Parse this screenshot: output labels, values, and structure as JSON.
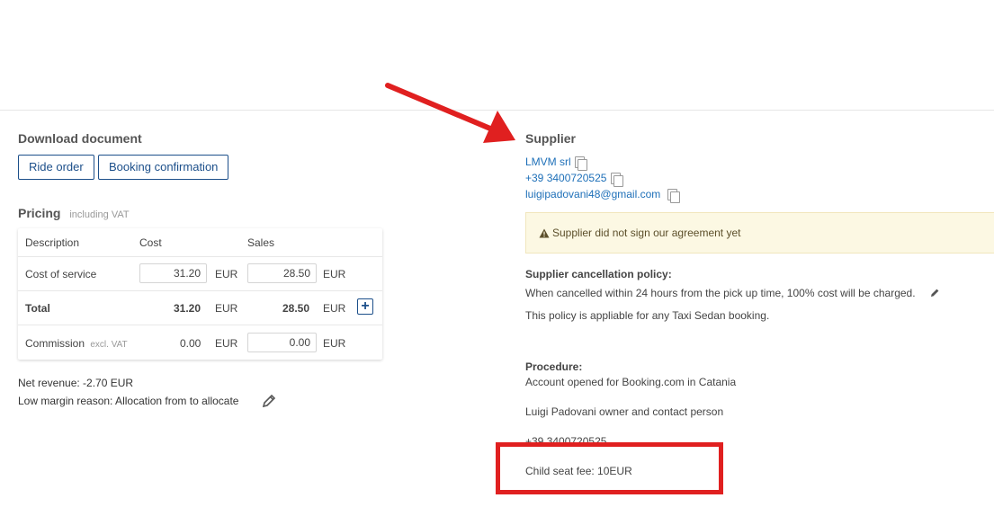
{
  "download": {
    "title": "Download document",
    "buttons": [
      "Ride order",
      "Booking confirmation"
    ]
  },
  "pricing": {
    "title": "Pricing",
    "subtitle": "including VAT",
    "headers": {
      "description": "Description",
      "cost": "Cost",
      "sales": "Sales"
    },
    "cost_of_service": {
      "label": "Cost of service",
      "cost": "31.20",
      "cost_currency": "EUR",
      "sales": "28.50",
      "sales_currency": "EUR"
    },
    "total": {
      "label": "Total",
      "cost": "31.20",
      "cost_currency": "EUR",
      "sales": "28.50",
      "sales_currency": "EUR",
      "add_button": "+"
    },
    "commission": {
      "label": "Commission",
      "note": "excl. VAT",
      "cost": "0.00",
      "cost_currency": "EUR",
      "sales": "0.00",
      "sales_currency": "EUR"
    },
    "net_revenue": "Net revenue: -2.70 EUR",
    "low_margin": "Low margin reason: Allocation from to allocate"
  },
  "supplier": {
    "title": "Supplier",
    "name": "LMVM srl",
    "phone": "+39 3400720525",
    "email": "luigipadovani48@gmail.com",
    "alert": "Supplier did not sign our agreement yet",
    "cancellation_title": "Supplier cancellation policy:",
    "cancellation_text": "When cancelled within 24 hours from the pick up time, 100% cost will be charged.",
    "policy_scope": "This policy is appliable for any Taxi Sedan booking.",
    "procedure_title": "Procedure:",
    "procedure_lines": [
      "Account opened for Booking.com in Catania",
      "Luigi Padovani owner and contact person",
      "+39 3400720525",
      "Child seat fee: 10EUR"
    ]
  },
  "colors": {
    "accent": "#1c4f8a",
    "link": "#1d6fb8",
    "annotation": "#e02020",
    "alert_bg": "#fcf8e3"
  }
}
